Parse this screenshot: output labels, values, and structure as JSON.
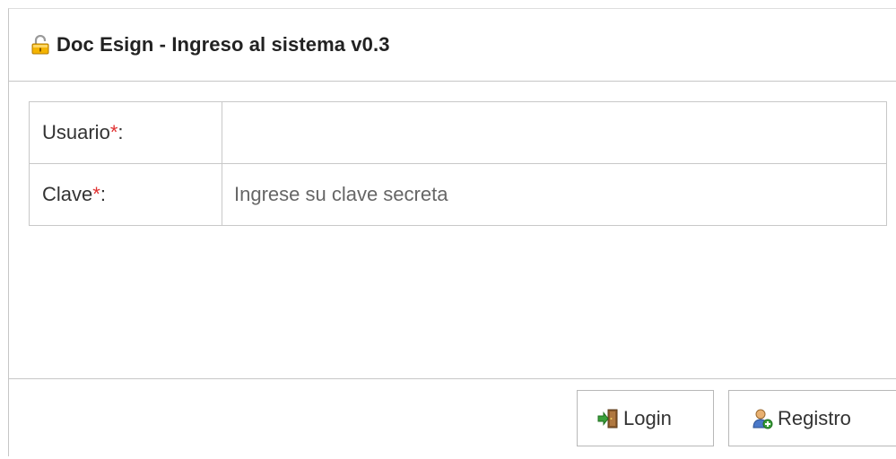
{
  "window": {
    "title": "Doc Esign - Ingreso al sistema v0.3",
    "title_icon": "lock-open-icon"
  },
  "form": {
    "fields": [
      {
        "label": "Usuario",
        "required_mark": "*",
        "separator": ":",
        "value": "",
        "placeholder": ""
      },
      {
        "label": "Clave",
        "required_mark": "*",
        "separator": ":",
        "value": "",
        "placeholder": "Ingrese su clave secreta"
      }
    ]
  },
  "footer": {
    "login_label": "Login",
    "login_icon": "door-enter-icon",
    "registro_label": "Registro",
    "registro_icon": "add-user-icon"
  },
  "colors": {
    "required": "#e03030",
    "border": "#c8c8c8"
  }
}
